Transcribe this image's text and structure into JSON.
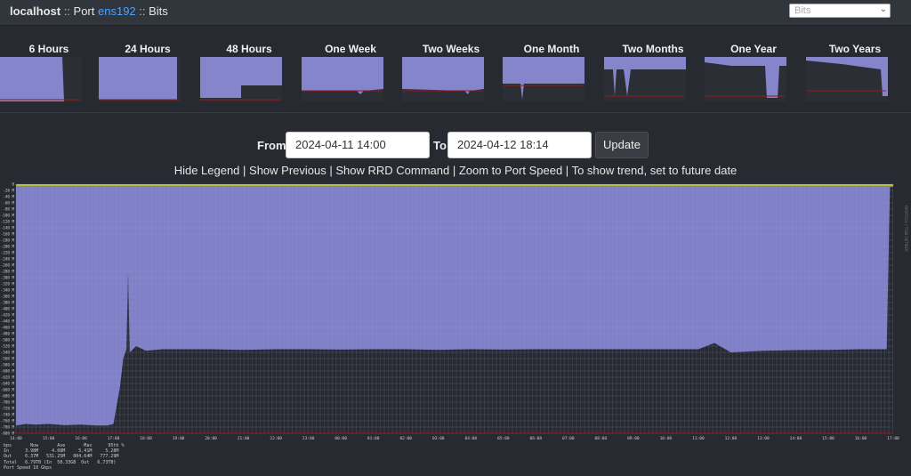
{
  "header": {
    "host": "localhost",
    "sep1": " :: ",
    "port_prefix": "Port ",
    "port": "ens192",
    "sep2": " :: ",
    "section": "Bits",
    "graph_type_value": "Bits"
  },
  "thumbnails": [
    "6 Hours",
    "24 Hours",
    "48 Hours",
    "One Week",
    "Two Weeks",
    "One Month",
    "Two Months",
    "One Year",
    "Two Years"
  ],
  "controls": {
    "from_label": "From",
    "from_value": "2024-04-11 14:00",
    "to_label": "To",
    "to_value": "2024-04-12 18:14",
    "update_label": "Update"
  },
  "links": [
    "Hide Legend",
    "Show Previous",
    "Show RRD Command",
    "Zoom to Port Speed",
    "To show trend, set to future date"
  ],
  "links_sep": " | ",
  "chart_data": {
    "type": "area",
    "y_tick_labels": [
      "0",
      "-20 M",
      "-40 M",
      "-60 M",
      "-80 M",
      "-100 M",
      "-120 M",
      "-140 M",
      "-160 M",
      "-180 M",
      "-200 M",
      "-220 M",
      "-240 M",
      "-260 M",
      "-280 M",
      "-300 M",
      "-320 M",
      "-340 M",
      "-360 M",
      "-380 M",
      "-400 M",
      "-420 M",
      "-440 M",
      "-460 M",
      "-480 M",
      "-500 M",
      "-520 M",
      "-540 M",
      "-560 M",
      "-580 M",
      "-600 M",
      "-620 M",
      "-640 M",
      "-660 M",
      "-680 M",
      "-700 M",
      "-720 M",
      "-740 M",
      "-760 M",
      "-780 M",
      "-800 M"
    ],
    "x_tick_labels": [
      "14:00",
      "15:00",
      "16:00",
      "17:00",
      "18:00",
      "19:00",
      "20:00",
      "21:00",
      "22:00",
      "23:00",
      "00:00",
      "01:00",
      "02:00",
      "03:00",
      "04:00",
      "05:00",
      "06:00",
      "07:00",
      "08:00",
      "09:00",
      "10:00",
      "11:00",
      "12:00",
      "13:00",
      "14:00",
      "15:00",
      "16:00",
      "17:00",
      "18:00"
    ],
    "ylim": [
      -800,
      0
    ],
    "y_unit": "M",
    "series": [
      {
        "name": "Out",
        "color": "#8080c8",
        "x": [
          14.0,
          14.3,
          14.6,
          15.0,
          15.5,
          16.0,
          16.5,
          16.8,
          17.0,
          17.2,
          17.3,
          17.4,
          17.45,
          17.5,
          17.7,
          18.0,
          18.5,
          19.0,
          19.5,
          20.0,
          21.0,
          22.0,
          23.0,
          24.0,
          25.0,
          26.0,
          27.0,
          28.0,
          29.0,
          30.0,
          31.0,
          32.0,
          33.0,
          34.0,
          35.0,
          35.5,
          36.0,
          37.0,
          38.0,
          39.0,
          40.0,
          40.8,
          40.9,
          41.0
        ],
        "values": [
          -775,
          -770,
          -772,
          -770,
          -774,
          -772,
          -775,
          -775,
          -770,
          -650,
          -560,
          -530,
          -280,
          -540,
          -520,
          -535,
          -530,
          -530,
          -530,
          -530,
          -532,
          -530,
          -530,
          -531,
          -530,
          -530,
          -532,
          -530,
          -531,
          -530,
          -530,
          -530,
          -530,
          -530,
          -530,
          -510,
          -540,
          -535,
          -533,
          -532,
          -530,
          -530,
          -10,
          -8
        ]
      },
      {
        "name": "In",
        "color": "#b8c038",
        "x": [
          14.0,
          41.0
        ],
        "values": [
          -3,
          -3
        ]
      }
    ],
    "port_speed_line": -800
  },
  "legend": {
    "header": "bps       Now       Ave       Max      95th %",
    "in": "In      3.98M     4.08M     5.41M     5.28M",
    "out": "Out     6.37M   531.25M   804.64M   777.29M",
    "total": "Total   6.79TB (In  58.33GB  Out   6.73TB)",
    "port_speed": "Port Speed 10 Gbps"
  },
  "watermark": "RRDTOOL / TOBI OETIKER",
  "colors": {
    "out": "#8080c8",
    "in": "#b8c038",
    "port_speed": "#a01818",
    "bg": "#272a31",
    "grid": "#9999c8"
  }
}
